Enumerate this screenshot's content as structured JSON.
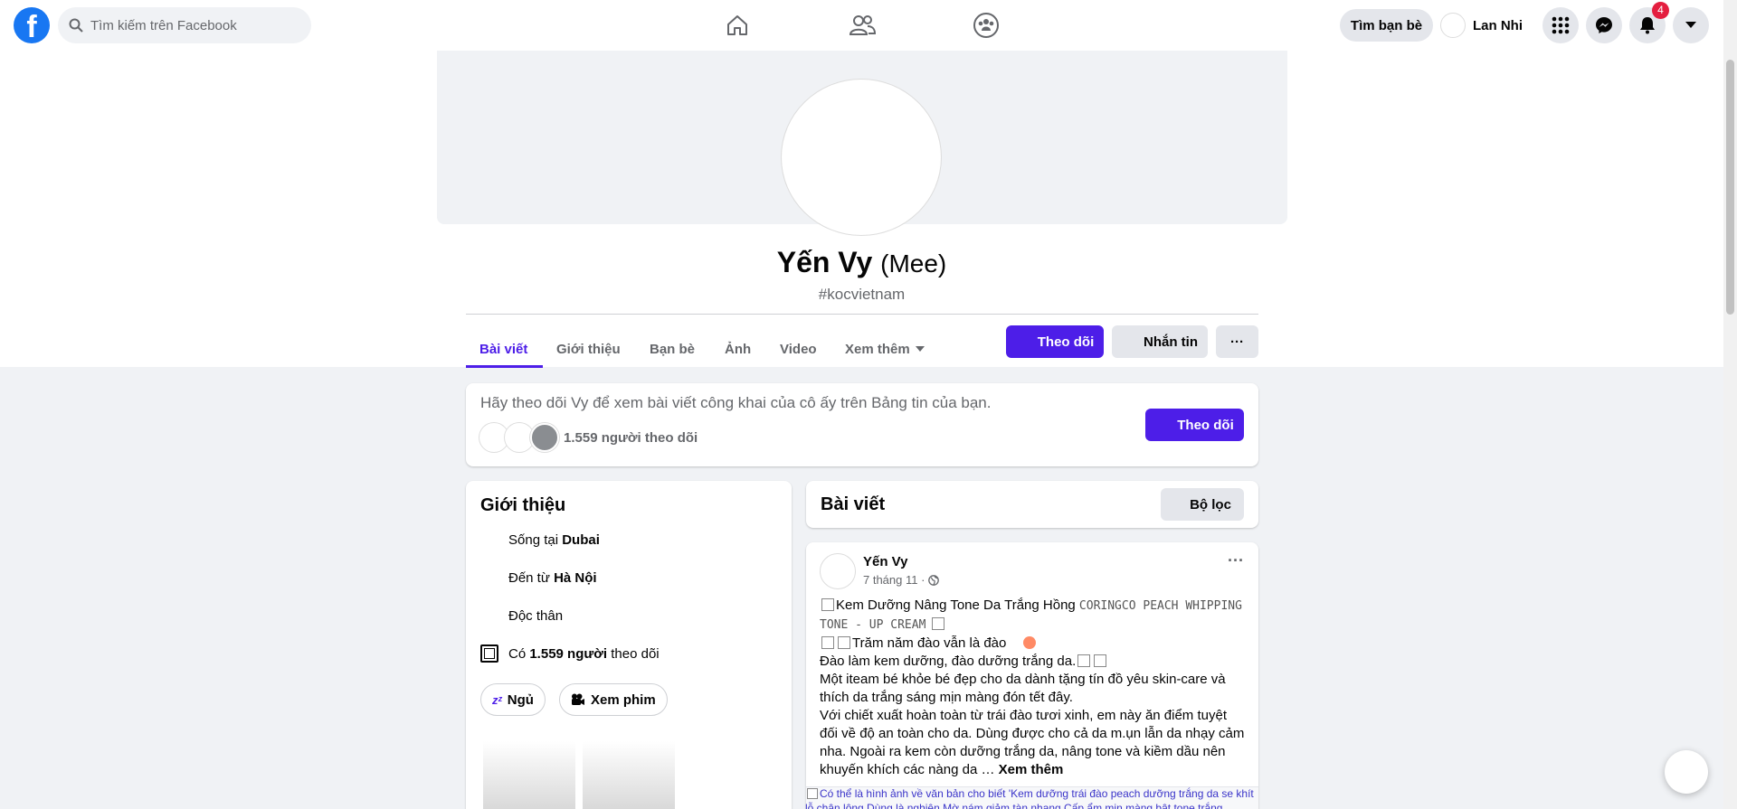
{
  "topbar": {
    "search_placeholder": "Tìm kiếm trên Facebook",
    "find_friends": "Tìm bạn bè",
    "user_name": "Lan Nhi",
    "notification_count": "4"
  },
  "profile": {
    "name": "Yến Vy",
    "alt_name": "(Mee)",
    "tagline": "#kocvietnam"
  },
  "tabs": [
    {
      "label": "Bài viết",
      "active": true
    },
    {
      "label": "Giới thiệu"
    },
    {
      "label": "Bạn bè"
    },
    {
      "label": "Ảnh"
    },
    {
      "label": "Video"
    },
    {
      "label": "Xem thêm"
    }
  ],
  "actions": {
    "follow": "Theo dõi",
    "message": "Nhắn tin",
    "more": "···"
  },
  "follow_card": {
    "text": "Hãy theo dõi Vy để xem bài viết công khai của cô ấy trên Bảng tin của bạn.",
    "followers": "1.559 người theo dõi",
    "button": "Theo dõi"
  },
  "intro": {
    "title": "Giới thiệu",
    "lives_in_prefix": "Sống tại ",
    "lives_in": "Dubai",
    "from_prefix": "Đến từ ",
    "from": "Hà Nội",
    "relationship": "Độc thân",
    "followers_prefix": "Có ",
    "followers_count": "1.559 người",
    "followers_suffix": " theo dõi",
    "hobbies": [
      "Ngủ",
      "Xem phim"
    ]
  },
  "posts_header": {
    "title": "Bài viết",
    "filter": "Bộ lọc"
  },
  "post": {
    "author": "Yến Vy",
    "date": "7 tháng 11 ·",
    "line1a": "Kem Dưỡng Nâng Tone Da Trắng Hồng ",
    "line1b": "CORINGCO PEACH WHIPPING TONE - UP CREAM",
    "line2": "Trăm năm đào vẫn là đào",
    "line3": "Đào làm kem dưỡng, đào dưỡng trắng da.",
    "line4": "Một iteam bé khỏe bé đẹp cho da dành tặng tín đồ yêu skin-care và thích da trắng sáng mịn màng đón tết đây.",
    "line5": "Với chiết xuất hoàn toàn từ trái đào  tươi xinh, em này ăn điểm tuyệt đối về độ an toàn cho da. Dùng được cho cả da m.ụn lẫn da nhạy cảm nha. Ngoài ra kem còn dưỡng trắng da, nâng tone và kiềm dầu nên khuyến khích các nàng da …",
    "see_more": "Xem thêm",
    "image_alt": "Có thể là hình ảnh về văn bản cho biết 'Kem dưỡng trái đào peach dưỡng trắng da se khít lỗ chân lông Dùng là nghiện Mờ nám giảm tàn nhang Cấp ẩm mịn màng bật tone trắng"
  }
}
